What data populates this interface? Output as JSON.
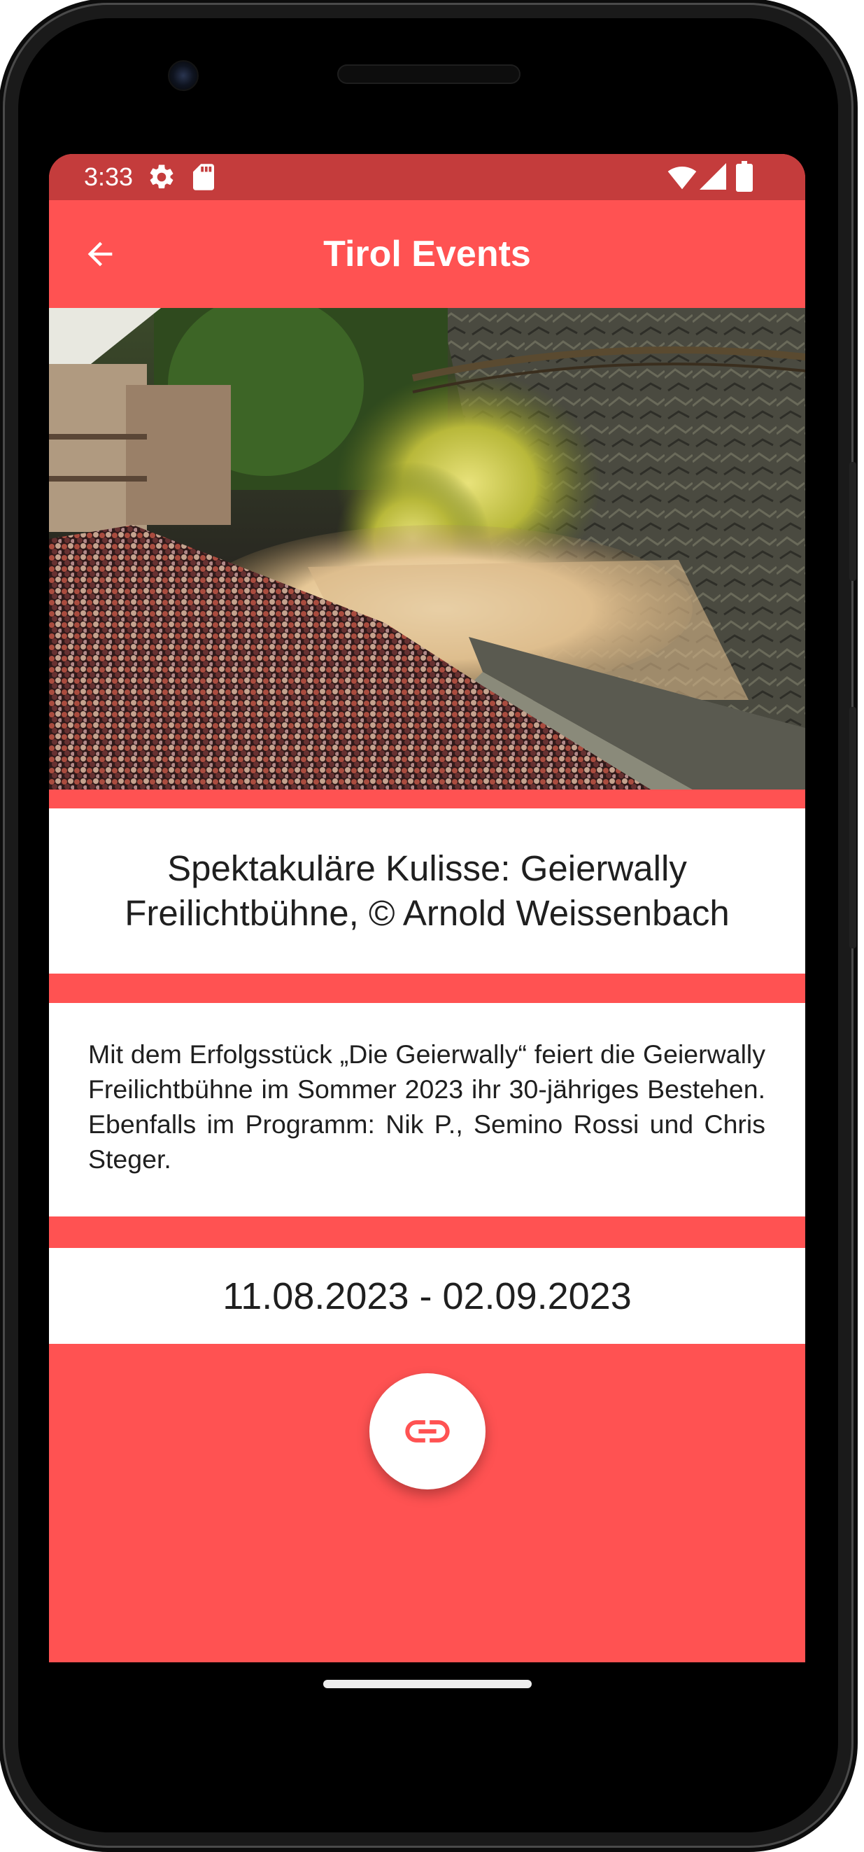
{
  "status_bar": {
    "time": "3:33",
    "icons": [
      "settings-gear-icon",
      "sd-card-icon",
      "wifi-icon",
      "signal-icon",
      "battery-icon"
    ]
  },
  "app_bar": {
    "title": "Tirol Events",
    "back_icon": "arrow-back-icon"
  },
  "event": {
    "image_caption": "Spektakuläre Kulisse: Geierwally Freilichtbühne, © Arnold Weissenbach",
    "description": "Mit dem Erfolgsstück „Die Geierwally“ feiert die Geierwally Freilichtbühne im Sommer 2023 ihr 30-jähriges Bestehen. Ebenfalls im Programm: Nik P., Semino Rossi und Chris Steger.",
    "date_range": "11.08.2023 - 02.09.2023",
    "link_icon": "link-icon"
  },
  "colors": {
    "primary": "#ff5252",
    "status_bar": "#c43c3c",
    "card": "#ffffff",
    "text": "#1f1f1f"
  }
}
